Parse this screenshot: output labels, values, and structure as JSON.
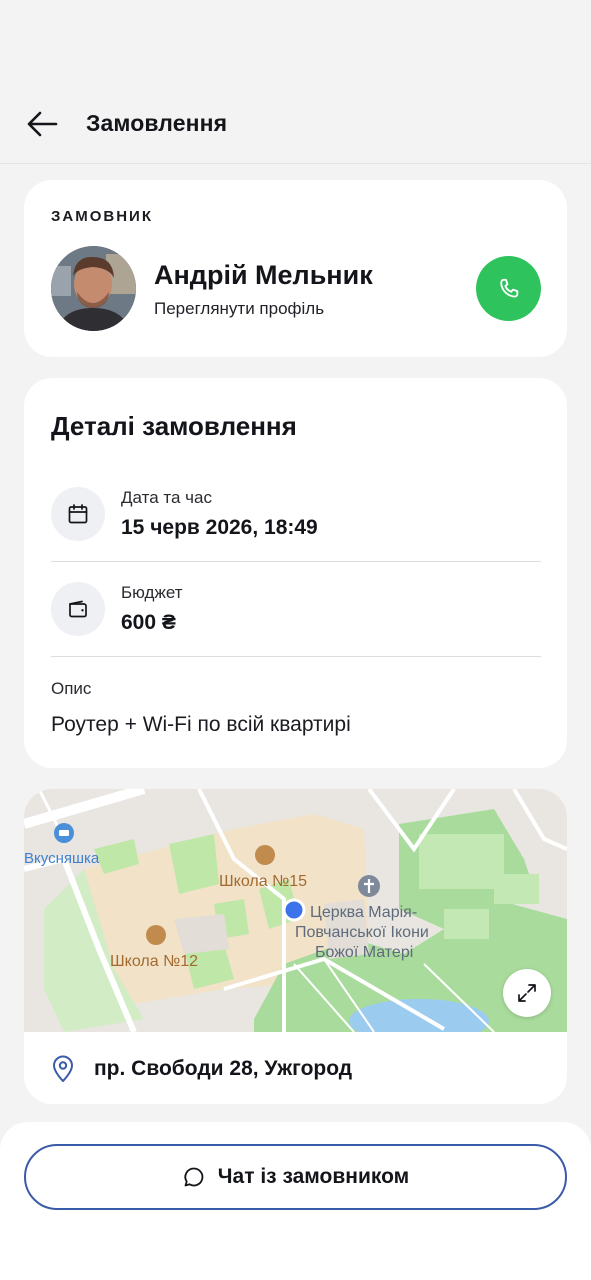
{
  "header": {
    "title": "Замовлення",
    "back_icon": "arrow-left-icon"
  },
  "customer": {
    "caption": "ЗАМОВНИК",
    "name": "Андрій Мельник",
    "profile_link": "Переглянути профіль",
    "call_icon": "phone-icon",
    "call_color": "#2ec35c"
  },
  "details": {
    "title": "Деталі замовлення",
    "date": {
      "label": "Дата та час",
      "value": "15 черв 2026, 18:49",
      "icon": "calendar-icon"
    },
    "budget": {
      "label": "Бюджет",
      "value": "600 ₴",
      "icon": "wallet-icon"
    },
    "description": {
      "label": "Опис",
      "value": "Роутер + Wi-Fi по всій квартирі"
    }
  },
  "map": {
    "labels": {
      "cafe": "Вкусняшка",
      "school15": "Школа №15",
      "school12": "Школа №12",
      "church_line1": "Церква Марія-",
      "church_line2": "Повчанської Ікони",
      "church_line3": "Божої Матері"
    },
    "expand_icon": "expand-icon",
    "address": "пр. Свободи 28, Ужгород",
    "pin_icon": "location-pin-icon"
  },
  "actions": {
    "chat_label": "Чат із замовником",
    "chat_icon": "chat-bubble-icon",
    "accent": "#3a5ca8"
  }
}
